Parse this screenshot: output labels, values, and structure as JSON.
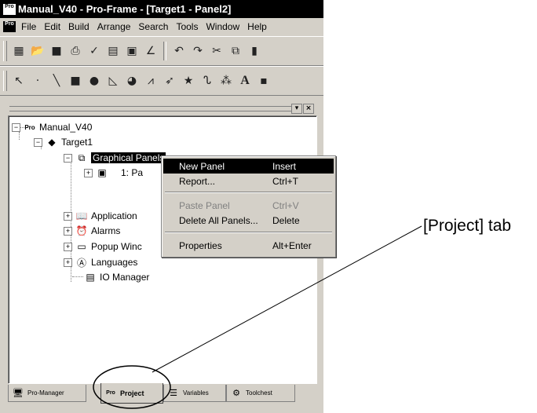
{
  "window": {
    "title": "Manual_V40 - Pro-Frame - [Target1 - Panel2]",
    "app_logo": "Pro"
  },
  "menu": {
    "items": [
      "File",
      "Edit",
      "Build",
      "Arrange",
      "Search",
      "Tools",
      "Window",
      "Help"
    ]
  },
  "toolbar1": {
    "icons": [
      "new-project-icon",
      "open-icon",
      "save-icon",
      "print-icon",
      "check-icon",
      "calendar-icon",
      "panel-icon",
      "wave-icon",
      "undo-icon",
      "redo-icon",
      "cut-icon",
      "copy-icon",
      "paste-icon"
    ]
  },
  "toolbar2": {
    "icons": [
      "pointer-icon",
      "dot-icon",
      "line-icon",
      "rectangle-icon",
      "ellipse-icon",
      "polygon-icon",
      "pie-icon",
      "polyline-icon",
      "arrow-icon",
      "star-icon",
      "bitmap-icon",
      "pattern-icon",
      "text-icon",
      "gauge-icon"
    ]
  },
  "tree": {
    "root": "Manual_V40",
    "target": "Target1",
    "graphical_panels": "Graphical Panels",
    "panel_item": "1: Pa",
    "application": "Application",
    "alarms": "Alarms",
    "popup_windows": "Popup Winc",
    "languages": "Languages",
    "io_manager": "IO Manager"
  },
  "context_menu": {
    "items": [
      {
        "label": "New Panel",
        "shortcut": "Insert"
      },
      {
        "label": "Report...",
        "shortcut": "Ctrl+T"
      },
      {
        "label": "Paste Panel",
        "shortcut": "Ctrl+V"
      },
      {
        "label": "Delete All Panels...",
        "shortcut": "Delete"
      },
      {
        "label": "Properties",
        "shortcut": "Alt+Enter"
      }
    ]
  },
  "tabs": {
    "pro_manager": "Pro-Manager",
    "project": "Project",
    "variables": "Variables",
    "toolchest": "Toolchest"
  },
  "annotation": {
    "label": "[Project] tab"
  },
  "colors": {
    "chrome": "#d4d0c8",
    "highlight": "#000000"
  }
}
